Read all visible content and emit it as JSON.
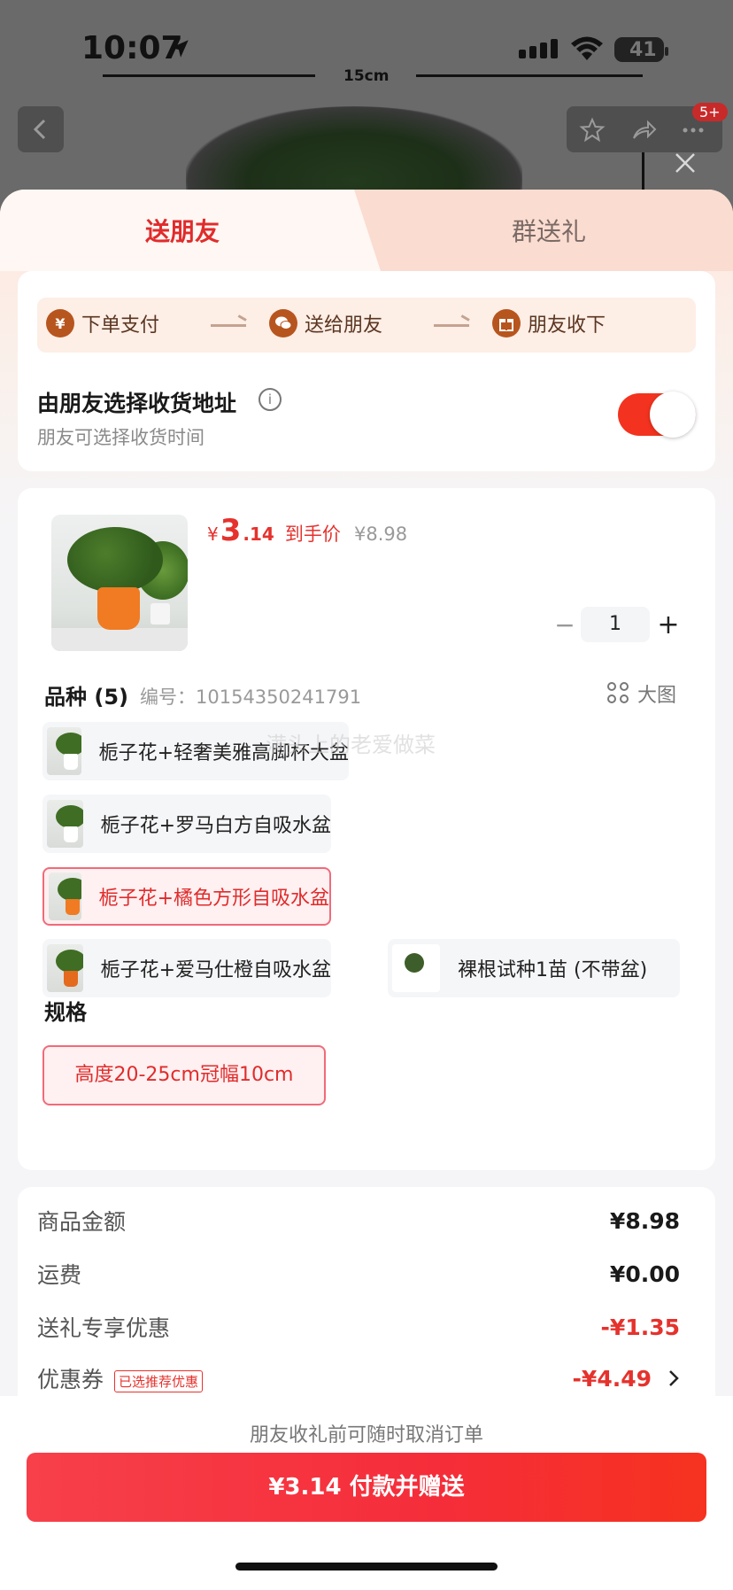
{
  "status_bar": {
    "time": "10:07",
    "battery": "41"
  },
  "background": {
    "ruler_label": "15cm",
    "notification_badge": "5+"
  },
  "tabs": {
    "active": "送朋友",
    "inactive": "群送礼"
  },
  "steps": [
    {
      "icon": "¥",
      "label": "下单支付"
    },
    {
      "icon": "chat",
      "label": "送给朋友"
    },
    {
      "icon": "gift",
      "label": "朋友收下"
    }
  ],
  "address": {
    "title": "由朋友选择收货地址",
    "subtitle": "朋友可选择收货时间",
    "toggle_on": true
  },
  "product": {
    "price_currency": "¥",
    "price_int": "3",
    "price_dec": ".14",
    "price_label": "到手价",
    "original_price": "¥8.98",
    "quantity": "1"
  },
  "variety": {
    "title": "品种 (5)",
    "code": "编号：10154350241791",
    "big_image_label": "大图",
    "watermark": "满头上的老爱做菜",
    "options": [
      {
        "label": "栀子花+轻奢美雅高脚杯大盆",
        "selected": false
      },
      {
        "label": "栀子花+罗马白方自吸水盆",
        "selected": false
      },
      {
        "label": "栀子花+橘色方形自吸水盆",
        "selected": true
      },
      {
        "label": "栀子花+爱马仕橙自吸水盆",
        "selected": false
      },
      {
        "label": "裸根试种1苗 (不带盆)",
        "selected": false
      }
    ]
  },
  "spec": {
    "title": "规格",
    "option": "高度20-25cm冠幅10cm"
  },
  "summary": [
    {
      "label": "商品金额",
      "value": "¥8.98",
      "red": false
    },
    {
      "label": "运费",
      "value": "¥0.00",
      "red": false
    },
    {
      "label": "送礼专享优惠",
      "value": "-¥1.35",
      "red": true
    },
    {
      "label": "优惠券",
      "tag": "已选推荐优惠",
      "value": "-¥4.49",
      "red": true
    }
  ],
  "footer": {
    "note": "朋友收礼前可随时取消订单",
    "pay_button": "¥3.14 付款并赠送"
  },
  "colors": {
    "accent_red": "#e5322d",
    "toggle": "#f3331f",
    "step_icon": "#b7551e"
  }
}
